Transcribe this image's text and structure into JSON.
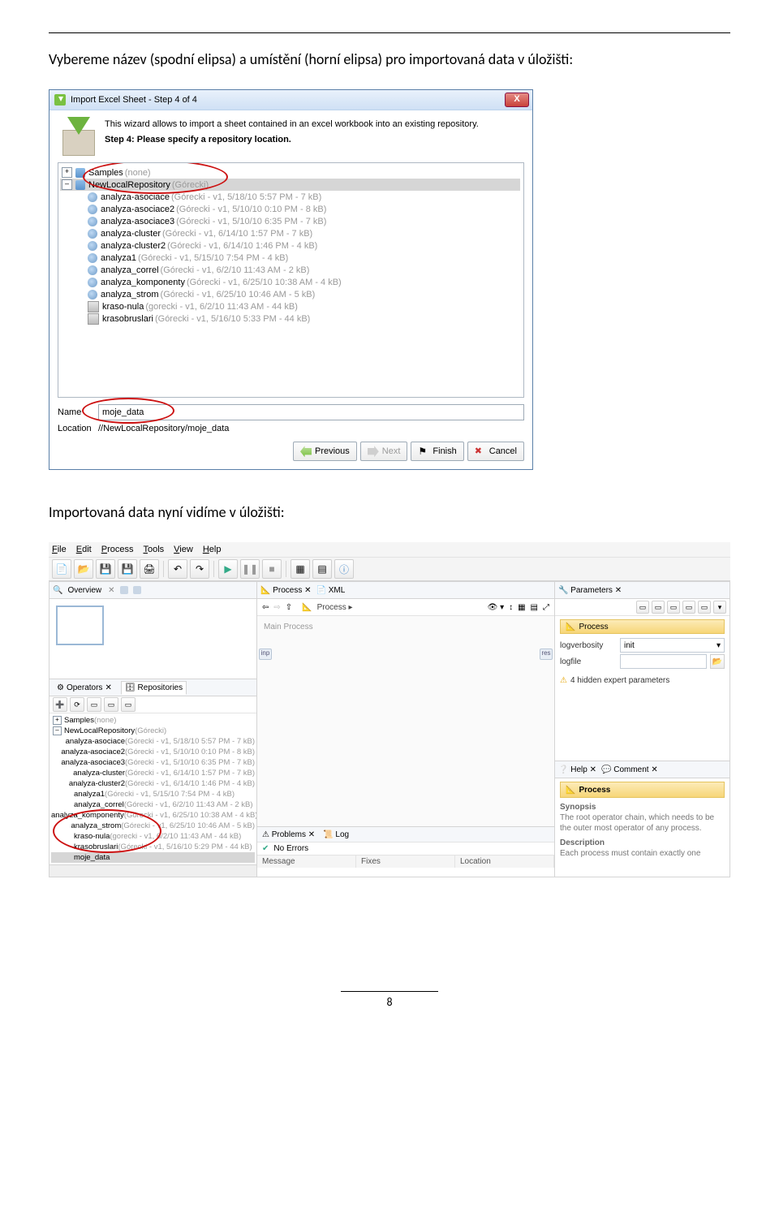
{
  "doc": {
    "para1": "Vybereme název (spodní elipsa) a umístění (horní elipsa) pro importovaná data v úložišti:",
    "para2": "Importovaná data nyní vidíme v úložišti:",
    "page_number": "8"
  },
  "dialog": {
    "title": "Import Excel Sheet - Step 4 of 4",
    "close": "X",
    "wizard_line1": "This wizard allows to import a sheet contained in an excel workbook into an existing repository.",
    "wizard_line2": "Step 4: Please specify a repository location.",
    "tree": {
      "root1": {
        "name": "Samples",
        "meta": "(none)"
      },
      "root2": {
        "name": "NewLocalRepository",
        "meta": "(Górecki)"
      },
      "items": [
        {
          "name": "analyza-asociace",
          "meta": "(Górecki - v1, 5/18/10 5:57 PM - 7 kB)"
        },
        {
          "name": "analyza-asociace2",
          "meta": "(Górecki - v1, 5/10/10 0:10 PM - 8 kB)"
        },
        {
          "name": "analyza-asociace3",
          "meta": "(Górecki - v1, 5/10/10 6:35 PM - 7 kB)"
        },
        {
          "name": "analyza-cluster",
          "meta": "(Górecki - v1, 6/14/10 1:57 PM - 7 kB)"
        },
        {
          "name": "analyza-cluster2",
          "meta": "(Górecki - v1, 6/14/10 1:46 PM - 4 kB)"
        },
        {
          "name": "analyza1",
          "meta": "(Górecki - v1, 5/15/10 7:54 PM - 4 kB)"
        },
        {
          "name": "analyza_correl",
          "meta": "(Górecki - v1, 6/2/10 11:43 AM - 2 kB)"
        },
        {
          "name": "analyza_komponenty",
          "meta": "(Górecki - v1, 6/25/10 10:38 AM - 4 kB)"
        },
        {
          "name": "analyza_strom",
          "meta": "(Górecki - v1, 6/25/10 10:46 AM - 5 kB)"
        },
        {
          "name": "kraso-nula",
          "meta": "(gorecki - v1, 6/2/10 11:43 AM - 44 kB)"
        },
        {
          "name": "krasobruslari",
          "meta": "(Górecki - v1, 5/16/10 5:33 PM - 44 kB)"
        }
      ]
    },
    "name_label": "Name",
    "name_value": "moje_data",
    "location_label": "Location",
    "location_value": "//NewLocalRepository/moje_data",
    "buttons": {
      "previous": "Previous",
      "next": "Next",
      "finish": "Finish",
      "cancel": "Cancel"
    }
  },
  "ide": {
    "menu": {
      "file": "File",
      "edit": "Edit",
      "process": "Process",
      "tools": "Tools",
      "view": "View",
      "help": "Help"
    },
    "overview_tab": "Overview",
    "operators_tab": "Operators",
    "repositories_tab": "Repositories",
    "repo": {
      "root1": {
        "name": "Samples",
        "meta": "(none)"
      },
      "root2": {
        "name": "NewLocalRepository",
        "meta": "(Górecki)"
      },
      "items": [
        {
          "name": "analyza-asociace",
          "meta": "(Górecki - v1, 5/18/10 5:57 PM - 7 kB)"
        },
        {
          "name": "analyza-asociace2",
          "meta": "(Górecki - v1, 5/10/10 0:10 PM - 8 kB)"
        },
        {
          "name": "analyza-asociace3",
          "meta": "(Górecki - v1, 5/10/10 6:35 PM - 7 kB)"
        },
        {
          "name": "analyza-cluster",
          "meta": "(Górecki - v1, 6/14/10 1:57 PM - 7 kB)"
        },
        {
          "name": "analyza-cluster2",
          "meta": "(Górecki - v1, 6/14/10 1:46 PM - 4 kB)"
        },
        {
          "name": "analyza1",
          "meta": "(Górecki - v1, 5/15/10 7:54 PM - 4 kB)"
        },
        {
          "name": "analyza_correl",
          "meta": "(Górecki - v1, 6/2/10 11:43 AM - 2 kB)"
        },
        {
          "name": "analyza_komponenty",
          "meta": "(Górecki - v1, 6/25/10 10:38 AM - 4 kB)"
        },
        {
          "name": "analyza_strom",
          "meta": "(Górecki - v1, 6/25/10 10:46 AM - 5 kB)"
        },
        {
          "name": "kraso-nula",
          "meta": "(gorecki - v1, 6/2/10 11:43 AM - 44 kB)"
        },
        {
          "name": "krasobruslari",
          "meta": "(Górecki - v1, 5/16/10 5:29 PM - 44 kB)"
        },
        {
          "name": "moje_data",
          "meta": ""
        }
      ]
    },
    "process_tab": "Process",
    "xml_tab": "XML",
    "breadcrumb": "Process ▸",
    "main_process": "Main Process",
    "port_in": "inp",
    "port_out": "res",
    "problems_tab": "Problems",
    "log_tab": "Log",
    "no_errors": "No Errors",
    "col_message": "Message",
    "col_fixes": "Fixes",
    "col_location": "Location",
    "parameters_tab": "Parameters",
    "process_banner": "Process",
    "logverbosity_label": "logverbosity",
    "logverbosity_value": "init",
    "logfile_label": "logfile",
    "hidden_params": "4 hidden expert parameters",
    "help_tab": "Help",
    "comment_tab": "Comment",
    "help_banner": "Process",
    "synopsis_h": "Synopsis",
    "synopsis_p": "The root operator chain, which needs to be the outer most operator of any process.",
    "description_h": "Description",
    "description_p": "Each process must contain exactly one"
  }
}
